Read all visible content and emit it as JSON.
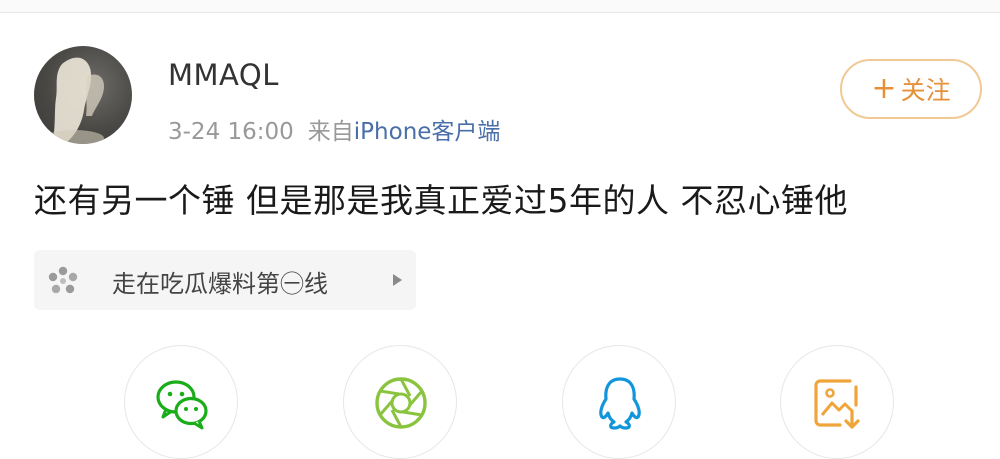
{
  "post": {
    "username": "MMAQL",
    "date": "3-24 16:00",
    "source_prefix": "来自",
    "source_link": "iPhone客户端",
    "follow_label": "关注",
    "follow_plus": "+",
    "text": "还有另一个锤 但是那是我真正爱过5年的人 不忍心锤他"
  },
  "topic": {
    "label": "走在吃瓜爆料第㊀线",
    "icon": "topic-flower-icon",
    "arrow": "play-right-icon"
  },
  "share_bar": {
    "items": [
      {
        "icon": "wechat-icon"
      },
      {
        "icon": "moments-aperture-icon"
      },
      {
        "icon": "qq-icon"
      },
      {
        "icon": "save-image-icon"
      }
    ]
  },
  "colors": {
    "follow_accent": "#e7903a",
    "follow_border": "#f0c995",
    "link": "#4a6fa8",
    "meta": "#999999",
    "wechat_green": "#1aad19",
    "moments_green": "#8ac43f",
    "qq_blue": "#1296db",
    "save_orange": "#f0a53b"
  }
}
